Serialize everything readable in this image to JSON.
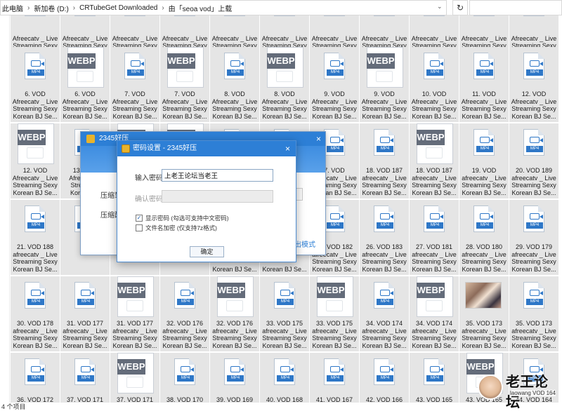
{
  "address_bar": {
    "crumbs": [
      "此电脑",
      "新加卷 (D:)",
      "CRTubeGet Downloaded",
      "由「seoa vod」上载"
    ],
    "refresh_icon": "refresh-icon",
    "search_placeholder": ""
  },
  "colors": {
    "titlebar": "#2d7fd6",
    "tile_background": "#e5e5e5",
    "mp4_badge": "#2e77c7",
    "webp_badge": "#646c7a"
  },
  "tile_rows": [
    {
      "kinds": [
        "mp4",
        "mp4",
        "mp4",
        "mp4",
        "mp4",
        "mp4",
        "mp4",
        "mp4",
        "mp4",
        "mp4",
        "mp4"
      ],
      "label1": [
        "",
        "",
        "",
        "",
        "",
        "",
        "",
        "",
        "",
        "",
        ""
      ],
      "label2": [
        "Afreecatv _ Live",
        "Afreecatv _ Live",
        "Afreecatv _ Live",
        "Afreecatv _ Live",
        "Afreecatv _ Live",
        "Afreecatv _ Live",
        "Afreecatv _ Live",
        "Afreecatv _ Live",
        "Afreecatv _ Live",
        "Afreecatv _ Live",
        "Afreecatv _ Live"
      ],
      "label3": [
        "Streaming Sexy",
        "Streaming Sexy",
        "Streaming Sexy",
        "Streaming Sexy",
        "Streaming Sexy",
        "Streaming Sexy",
        "Streaming Sexy",
        "Streaming Sexy",
        "Streaming Sexy",
        "Streaming Sexy",
        "Streaming Sexy"
      ],
      "label4": [
        "Korean BJ Se...",
        "Korean BJ Se...",
        "Korean BJ Se...",
        "Korean BJ Se...",
        "Korean BJ Se...",
        "Korean BJ Se...",
        "Korean BJ Se...",
        "Korean BJ Se...",
        "Korean BJ Se...",
        "Korean BJ Se...",
        "Korean BJ Se..."
      ]
    },
    {
      "kinds": [
        "mp4",
        "webp",
        "mp4",
        "webp",
        "mp4",
        "webp",
        "mp4",
        "webp",
        "mp4",
        "mp4",
        "mp4"
      ],
      "label1": [
        "6. VOD",
        "6. VOD",
        "7. VOD",
        "7. VOD",
        "8. VOD",
        "8. VOD",
        "9. VOD",
        "9. VOD",
        "10. VOD",
        "11. VOD",
        "12. VOD"
      ],
      "label2": [
        "Afreecatv _ Live",
        "Afreecatv _ Live",
        "Afreecatv _ Live",
        "Afreecatv _ Live",
        "Afreecatv _ Live",
        "Afreecatv _ Live",
        "Afreecatv _ Live",
        "Afreecatv _ Live",
        "Afreecatv _ Live",
        "Afreecatv _ Live",
        "Afreecatv _ Live"
      ],
      "label3": [
        "Streaming Sexy",
        "Streaming Sexy",
        "Streaming Sexy",
        "Streaming Sexy",
        "Streaming Sexy",
        "Streaming Sexy",
        "Streaming Sexy",
        "Streaming Sexy",
        "Streaming Sexy",
        "Streaming Sexy",
        "Streaming Sexy"
      ],
      "label4": [
        "Korean BJ Se...",
        "Korean BJ Se...",
        "Korean BJ Se...",
        "Korean BJ Se...",
        "Korean BJ Se...",
        "Korean BJ Se...",
        "Korean BJ Se...",
        "Korean BJ Se...",
        "Korean BJ Se...",
        "Korean BJ Se...",
        "Korean BJ Se..."
      ]
    },
    {
      "kinds": [
        "webp",
        "mp4",
        "webp",
        "webp",
        "mp4",
        "mp4",
        "mp4",
        "mp4",
        "webp",
        "mp4",
        "mp4"
      ],
      "label1": [
        "12. VOD",
        "13. VOD",
        "",
        "",
        "",
        "",
        "7. VOD",
        "18. VOD 187",
        "18. VOD 187",
        "19. VOD",
        "20. VOD 189"
      ],
      "label2": [
        "Afreecatv _ Live",
        "Afreecatv _",
        "",
        "",
        "",
        "",
        "afreecatv _ Live",
        "afreecatv _ Live",
        "afreecatv _ Live",
        "afreecatv _ Live",
        "afreecatv _ Live"
      ],
      "label3": [
        "Streaming Sexy",
        "Streaming",
        "",
        "",
        "",
        "",
        "Streaming Sexy",
        "Streaming Sexy",
        "Streaming Sexy",
        "Streaming Sexy",
        "Streaming Sexy"
      ],
      "label4": [
        "Korean BJ Se...",
        "Korean BJ",
        "",
        "",
        "",
        "",
        "Korean BJ Se...",
        "Korean BJ Se...",
        "Korean BJ Se...",
        "Korean BJ Se...",
        "Korean BJ Se..."
      ]
    },
    {
      "kinds": [
        "mp4",
        "mp4",
        "mp4",
        "mp4",
        "mp4",
        "mp4",
        "mp4",
        "mp4",
        "mp4",
        "mp4",
        "mp4"
      ],
      "label1": [
        "21. VOD 188",
        "",
        "",
        "",
        "",
        "",
        "26. VOD 182",
        "26. VOD 183",
        "27. VOD 181",
        "28. VOD 180",
        "29. VOD 179"
      ],
      "label2": [
        "afreecatv _ Live",
        "",
        "",
        "",
        "",
        "",
        "afreecatv _ Live",
        "afreecatv _ Live",
        "afreecatv _ Live",
        "afreecatv _ Live",
        "afreecatv _ Live"
      ],
      "label3": [
        "Streaming Sexy",
        "",
        "",
        "",
        "",
        "",
        "Streaming Sexy",
        "Streaming Sexy",
        "Streaming Sexy",
        "Streaming Sexy",
        "Streaming Sexy"
      ],
      "label4": [
        "Korean BJ Se...",
        "",
        "",
        "",
        "Korean BJ Se...",
        "Korean BJ Se...",
        "Korean BJ Se...",
        "Korean BJ Se...",
        "Korean BJ Se...",
        "Korean BJ Se...",
        "Korean BJ Se..."
      ]
    },
    {
      "kinds": [
        "mp4",
        "mp4",
        "webp",
        "mp4",
        "webp",
        "mp4",
        "webp",
        "mp4",
        "webp",
        "photo",
        "mp4"
      ],
      "label1": [
        "30. VOD 178",
        "31. VOD 177",
        "31. VOD 177",
        "32. VOD 176",
        "32. VOD 176",
        "33. VOD 175",
        "33. VOD 175",
        "34. VOD 174",
        "34. VOD 174",
        "35. VOD 173",
        "35. VOD 173"
      ],
      "label2": [
        "afreecatv _ Live",
        "afreecatv _ Live",
        "afreecatv _ Live",
        "afreecatv _ Live",
        "afreecatv _ Live",
        "afreecatv _ Live",
        "afreecatv _ Live",
        "afreecatv _ Live",
        "afreecatv _ Live",
        "afreecatv _ Live",
        "afreecatv _ Live"
      ],
      "label3": [
        "Streaming Sexy",
        "Streaming Sexy",
        "Streaming Sexy",
        "Streaming Sexy",
        "Streaming Sexy",
        "Streaming Sexy",
        "Streaming Sexy",
        "Streaming Sexy",
        "Streaming Sexy",
        "Streaming Sexy",
        "Streaming Sexy"
      ],
      "label4": [
        "Korean BJ Se...",
        "Korean BJ Se...",
        "Korean BJ Se...",
        "Korean BJ Se...",
        "Korean BJ Se...",
        "Korean BJ Se...",
        "Korean BJ Se...",
        "Korean BJ Se...",
        "Korean BJ Se...",
        "Korean BJ Se...",
        "Korean BJ Se..."
      ]
    },
    {
      "kinds": [
        "mp4",
        "mp4",
        "webp",
        "mp4",
        "mp4",
        "mp4",
        "mp4",
        "mp4",
        "mp4",
        "webp",
        "mp4"
      ],
      "label1": [
        "36. VOD 172",
        "37. VOD 171",
        "37. VOD 171",
        "38. VOD 170",
        "39. VOD 169",
        "40. VOD 168",
        "41. VOD 167",
        "42. VOD 166",
        "43. VOD 165",
        "43. VOD 165",
        "44. VOD 164"
      ],
      "label2": [
        "afreecatv _ Live",
        "afreecatv _ Live",
        "afreecatv _ Live",
        "afreecatv _ Live",
        "afreecatv _ Live",
        "afreecatv _ Live",
        "afreecatv _ Live",
        "afreecatv _ Live",
        "afreecatv _ Live",
        "afreecatv _ Live",
        "afreecatv _ Live"
      ],
      "label3": [
        "",
        "",
        "",
        "",
        "",
        "",
        "",
        "",
        "",
        "",
        ""
      ],
      "label4": [
        "",
        "",
        "",
        "",
        "",
        "",
        "",
        "",
        "",
        "",
        ""
      ]
    }
  ],
  "statusbar": {
    "item_count": "4 个项目"
  },
  "bg_dialog": {
    "title": "2345好压",
    "close_glyph": "×",
    "row1_label": "压缩到",
    "row2_label": "压缩配置",
    "link_text": "出模式"
  },
  "password_dialog": {
    "title": "密码设置 - 2345好压",
    "close_glyph": "×",
    "password_label": "输入密码",
    "password_value": "上老王论坛当老王",
    "confirm_label": "确认密码",
    "show_password_label": "显示密码 (勾选可支持中文密码)",
    "show_password_checked": true,
    "encrypt_filename_label": "文件名加密 (仅支持7z格式)",
    "encrypt_filename_checked": false,
    "ok_label": "确定"
  },
  "watermark": {
    "text": "老王论坛",
    "sub": "laowang VOD 164"
  }
}
